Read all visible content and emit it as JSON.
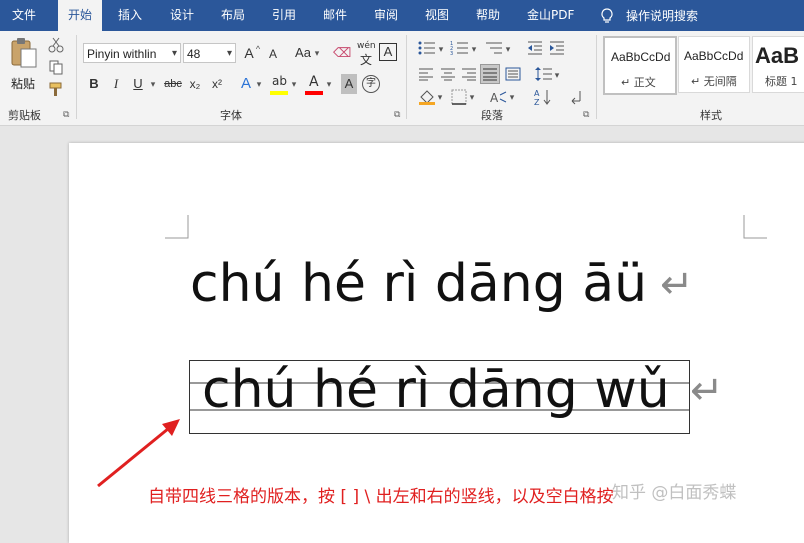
{
  "tabs": [
    {
      "label": "文件",
      "active": false
    },
    {
      "label": "开始",
      "active": true
    },
    {
      "label": "插入",
      "active": false
    },
    {
      "label": "设计",
      "active": false
    },
    {
      "label": "布局",
      "active": false
    },
    {
      "label": "引用",
      "active": false
    },
    {
      "label": "邮件",
      "active": false
    },
    {
      "label": "审阅",
      "active": false
    },
    {
      "label": "视图",
      "active": false
    },
    {
      "label": "帮助",
      "active": false
    },
    {
      "label": "金山PDF",
      "active": false
    }
  ],
  "tell_me": "操作说明搜索",
  "ribbon": {
    "clipboard": {
      "label": "剪贴板",
      "paste": "粘贴"
    },
    "font": {
      "label": "字体",
      "font_name": "Pinyin withlin",
      "font_size": "48",
      "grow": "A",
      "shrink": "A",
      "change_case": "Aa",
      "phonetic_top": "wén",
      "phonetic_bottom": "文",
      "border_char": "A",
      "bold": "B",
      "italic": "I",
      "underline": "U",
      "strike": "abc",
      "subscript": "x₂",
      "superscript": "x²",
      "text_effects": "A",
      "highlight": "ab",
      "font_color": "A",
      "shading": "A",
      "enclose": "字"
    },
    "paragraph": {
      "label": "段落"
    },
    "styles": {
      "label": "样式",
      "items": [
        {
          "sample": "AaBbCcDd",
          "name": "↵ 正文"
        },
        {
          "sample": "AaBbCcDd",
          "name": "↵ 无间隔"
        },
        {
          "sample": "AaB",
          "name": "标题 1"
        }
      ]
    }
  },
  "document": {
    "line1": "chú hé rì dāng āü",
    "line2": "chú hé rì dāng wǔ",
    "paragraph_mark": "↵"
  },
  "annotation": "自带四线三格的版本，按 [   ]   \\   出左和右的竖线，以及空白格按",
  "watermark": "知乎 @白面秀蝶",
  "colors": {
    "tab_bar": "#2b579a",
    "annotation": "#e02020",
    "highlight_bar": "#ffff00",
    "font_color_bar": "#ff0000"
  }
}
